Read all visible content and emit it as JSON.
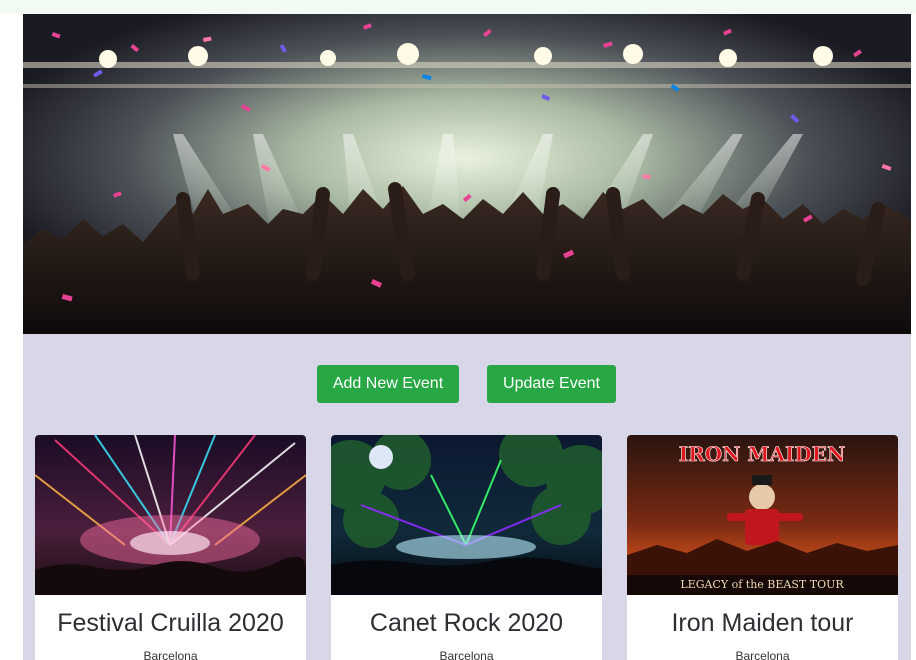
{
  "hero": {
    "image": "concert-crowd-confetti-image"
  },
  "actions": {
    "add_label": "Add New Event",
    "update_label": "Update Event",
    "button_color": "#28a745"
  },
  "events": [
    {
      "title": "Festival Cruilla 2020",
      "city": "Barcelona",
      "image": "festival-lights-stage-image"
    },
    {
      "title": "Canet Rock 2020",
      "city": "Barcelona",
      "image": "outdoor-stage-lasers-image"
    },
    {
      "title": "Iron Maiden tour",
      "city": "Barcelona",
      "image": "iron-maiden-poster-image",
      "poster_text": "IRON MAIDEN",
      "poster_subtitle": "LEGACY of the BEAST TOUR"
    }
  ],
  "colors": {
    "content_background": "#d8d7e7",
    "top_band": "#f1fbf4"
  }
}
